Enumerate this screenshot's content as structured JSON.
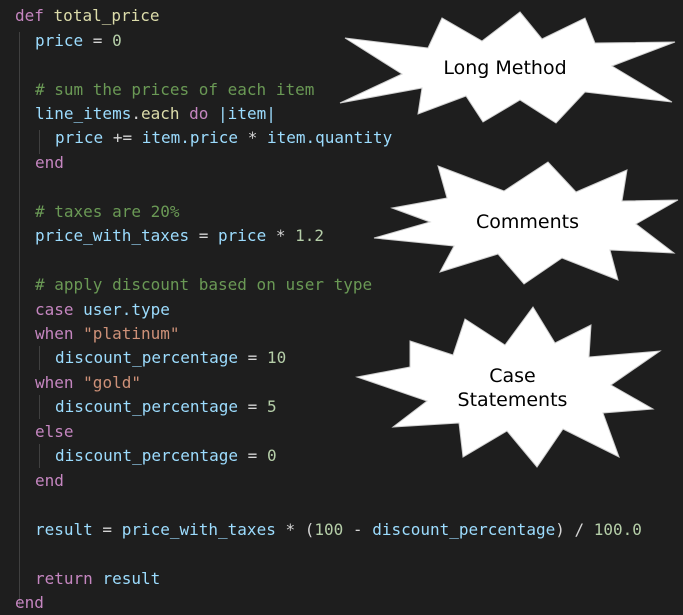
{
  "code": {
    "def_kw": "def",
    "method_name": "total_price",
    "price_var": "price",
    "zero": "0",
    "comment_sum": "# sum the prices of each item",
    "line_items": "line_items",
    "each": "each",
    "do_kw": "do",
    "block_param": "|item|",
    "price_inc_lhs": "price",
    "plus_eq": "+=",
    "item_price": "item.price",
    "times": "*",
    "item_qty": "item.quantity",
    "end_kw": "end",
    "comment_tax": "# taxes are 20%",
    "price_with_taxes": "price_with_taxes",
    "tax_rate": "1.2",
    "comment_discount": "# apply discount based on user type",
    "case_kw": "case",
    "user_type": "user.type",
    "when_kw": "when",
    "str_platinum": "\"platinum\"",
    "discount_percentage": "discount_percentage",
    "ten": "10",
    "str_gold": "\"gold\"",
    "five": "5",
    "else_kw": "else",
    "result_var": "result",
    "hundred": "100",
    "hundred_float": "100.0",
    "return_kw": "return"
  },
  "callouts": [
    {
      "label": "Long Method"
    },
    {
      "label": "Comments"
    },
    {
      "label": "Case\nStatements"
    }
  ]
}
